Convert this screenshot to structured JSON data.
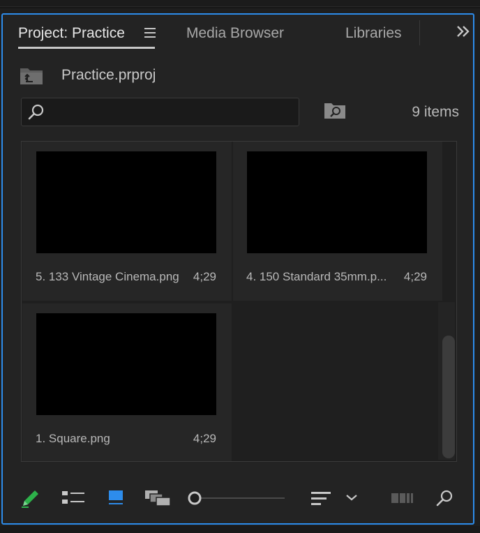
{
  "tabs": {
    "project": "Project: Practice",
    "media_browser": "Media Browser",
    "libraries": "Libraries"
  },
  "path": {
    "label": "Practice.prproj"
  },
  "search": {
    "placeholder": "",
    "value": ""
  },
  "item_count": "9 items",
  "items": [
    {
      "name": "5. 133 Vintage Cinema.png",
      "duration": "4;29"
    },
    {
      "name": "4. 150 Standard 35mm.p...",
      "duration": "4;29"
    },
    {
      "name": "1. Square.png",
      "duration": "4;29"
    }
  ],
  "icons": {
    "tab_menu": "hamburger-icon",
    "overflow": "double-chevron-right-icon",
    "folder_up": "folder-up-icon",
    "search": "search-icon",
    "bin_search": "bin-search-icon",
    "pencil": "pencil-icon",
    "list_view": "list-view-icon",
    "icon_view": "icon-view-icon",
    "freeform_view": "freeform-view-icon",
    "zoom_slider": "zoom-slider",
    "sort": "sort-icon",
    "sort_menu": "chevron-down-icon",
    "automate": "automate-to-sequence-icon",
    "find": "find-icon"
  },
  "colors": {
    "accent_border": "#2d8ceb",
    "pencil": "#2db14a",
    "icon_view_active": "#2d8ceb"
  },
  "zoom_level": 0
}
